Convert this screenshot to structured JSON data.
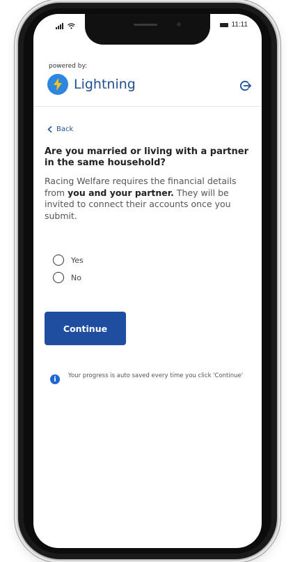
{
  "status_bar": {
    "time": "11:11"
  },
  "header": {
    "powered_by": "powered by:",
    "brand_name": "Lightning"
  },
  "nav": {
    "back_label": "Back"
  },
  "form": {
    "question": "Are you married or living with a partner in the same household?",
    "description_parts": {
      "before": "Racing Welfare requires the financial details from ",
      "bold": "you and your partner.",
      "after": " They will be invited to connect their accounts once you submit."
    },
    "options": [
      {
        "label": "Yes"
      },
      {
        "label": "No"
      }
    ],
    "continue_label": "Continue"
  },
  "info": {
    "message": "Your progress is auto saved every time you click 'Continue'"
  },
  "colors": {
    "brand_blue": "#1d4f91",
    "button_blue": "#1f4ea1",
    "logo_blue": "#2e86de",
    "info_blue": "#1f67d2"
  }
}
